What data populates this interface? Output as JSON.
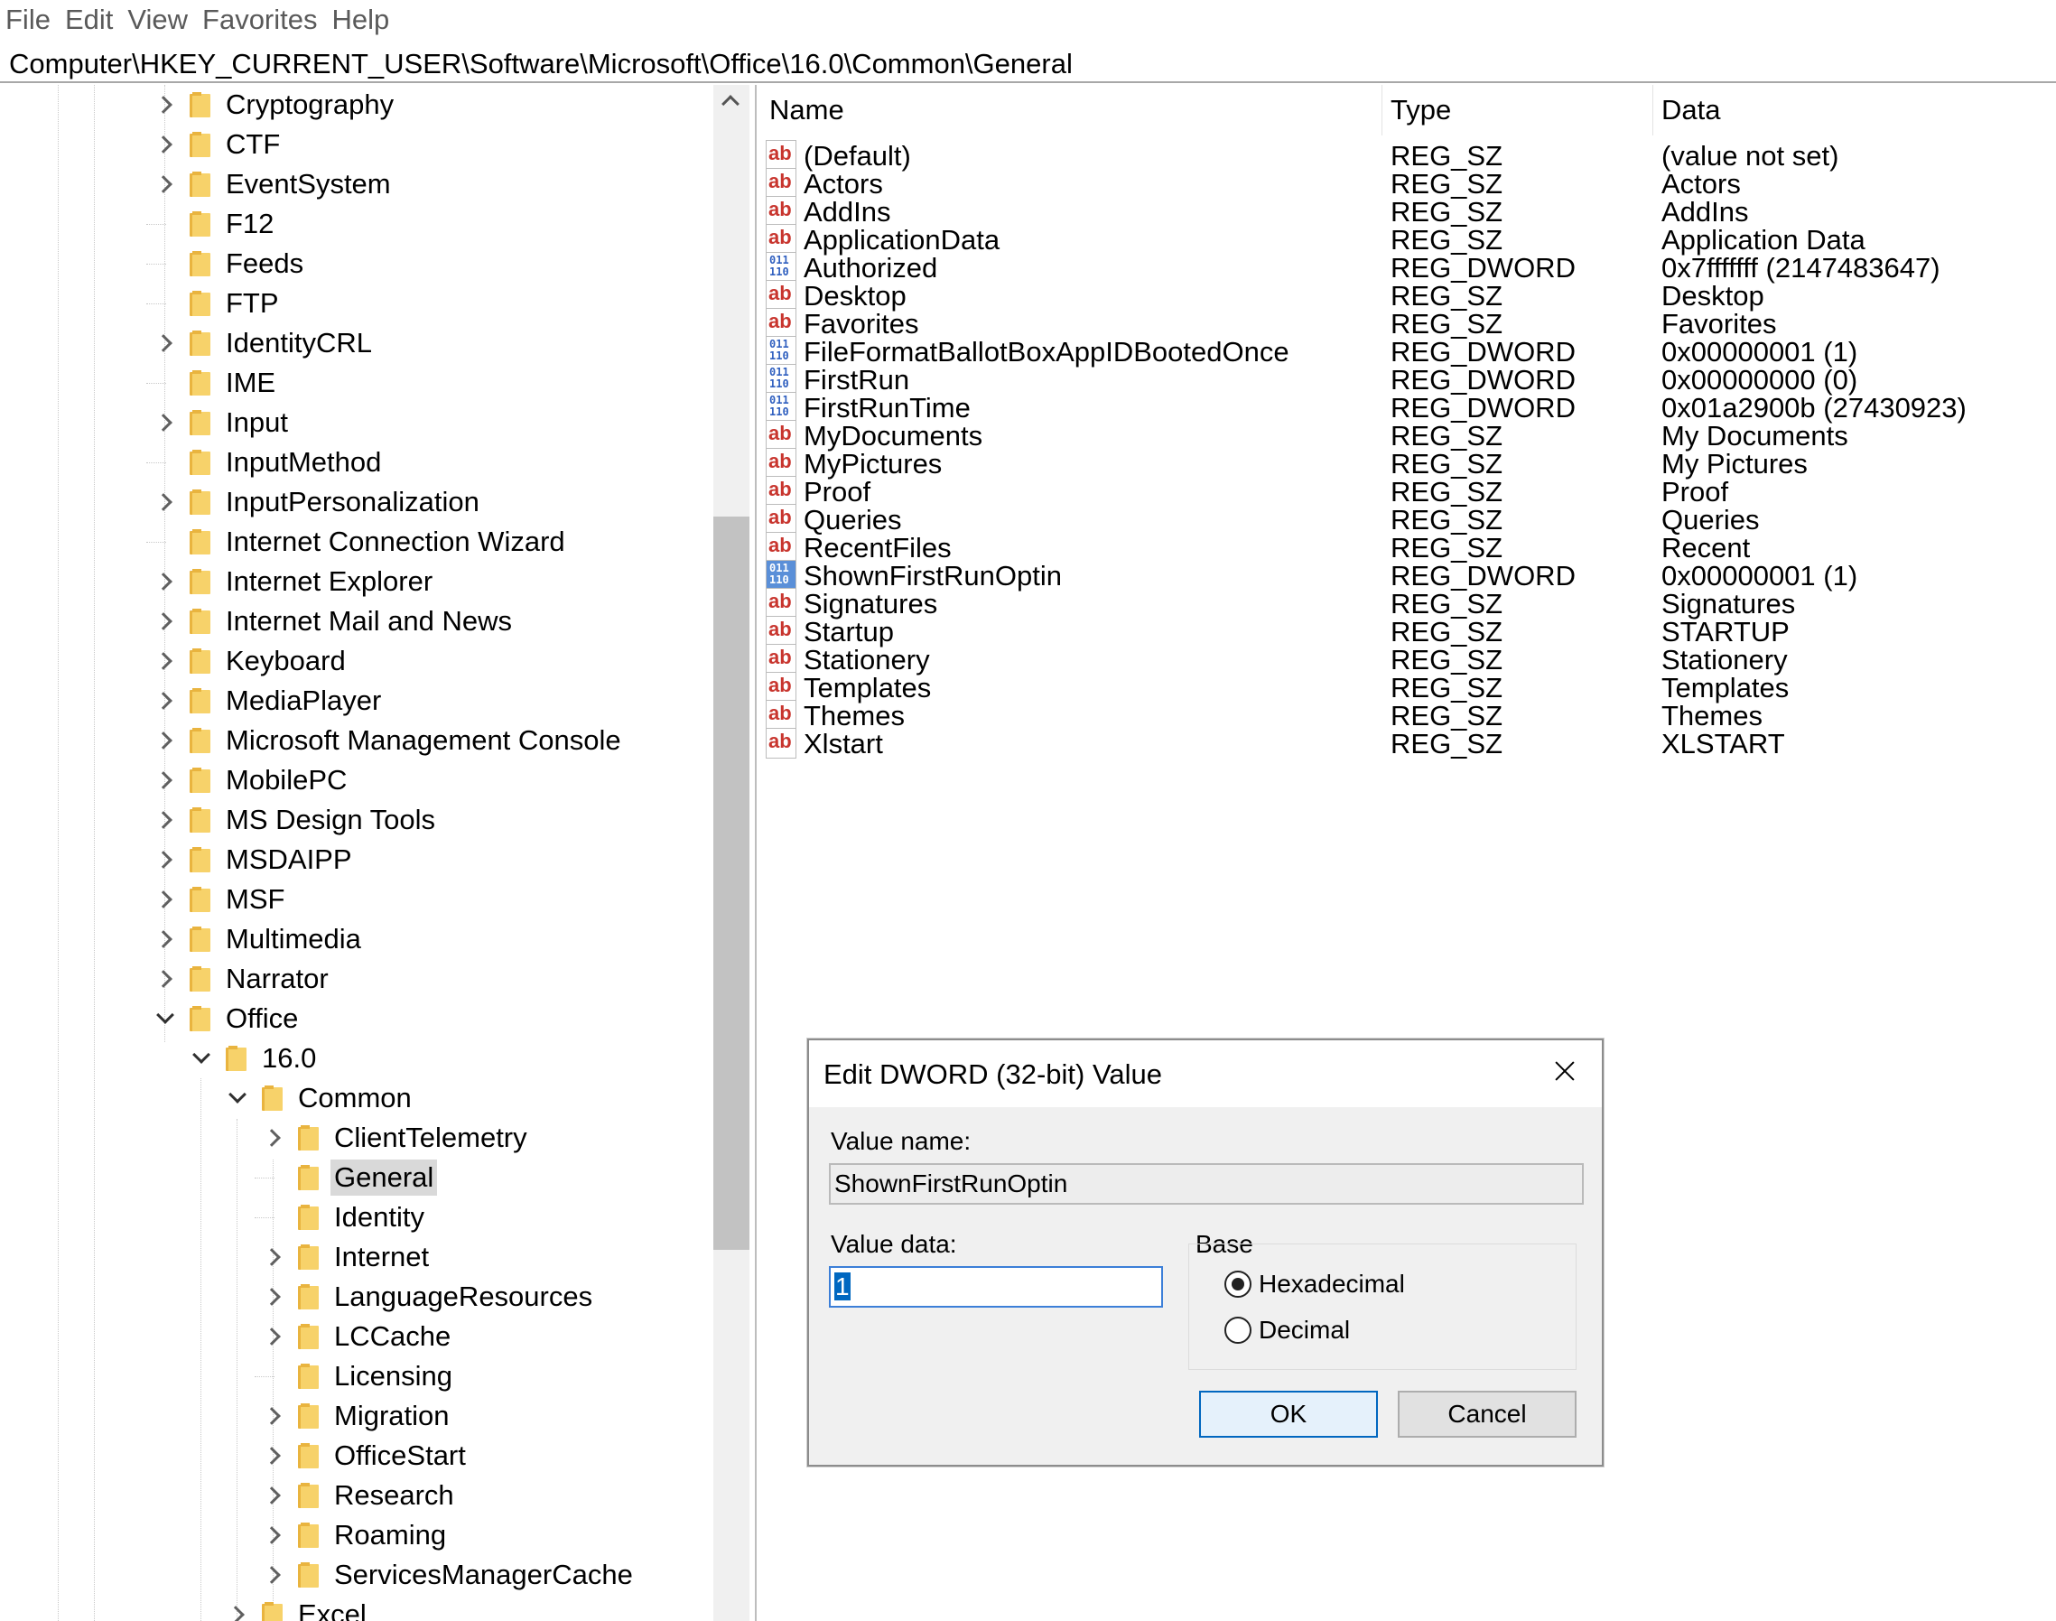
{
  "menu": [
    "File",
    "Edit",
    "View",
    "Favorites",
    "Help"
  ],
  "address": "Computer\\HKEY_CURRENT_USER\\Software\\Microsoft\\Office\\16.0\\Common\\General",
  "tree": [
    {
      "label": "Cryptography",
      "level": 0,
      "expander": "right"
    },
    {
      "label": "CTF",
      "level": 0,
      "expander": "right"
    },
    {
      "label": "EventSystem",
      "level": 0,
      "expander": "right"
    },
    {
      "label": "F12",
      "level": 0,
      "expander": "none"
    },
    {
      "label": "Feeds",
      "level": 0,
      "expander": "none"
    },
    {
      "label": "FTP",
      "level": 0,
      "expander": "none"
    },
    {
      "label": "IdentityCRL",
      "level": 0,
      "expander": "right"
    },
    {
      "label": "IME",
      "level": 0,
      "expander": "none"
    },
    {
      "label": "Input",
      "level": 0,
      "expander": "right"
    },
    {
      "label": "InputMethod",
      "level": 0,
      "expander": "none"
    },
    {
      "label": "InputPersonalization",
      "level": 0,
      "expander": "right"
    },
    {
      "label": "Internet Connection Wizard",
      "level": 0,
      "expander": "none"
    },
    {
      "label": "Internet Explorer",
      "level": 0,
      "expander": "right"
    },
    {
      "label": "Internet Mail and News",
      "level": 0,
      "expander": "right"
    },
    {
      "label": "Keyboard",
      "level": 0,
      "expander": "right"
    },
    {
      "label": "MediaPlayer",
      "level": 0,
      "expander": "right"
    },
    {
      "label": "Microsoft Management Console",
      "level": 0,
      "expander": "right"
    },
    {
      "label": "MobilePC",
      "level": 0,
      "expander": "right"
    },
    {
      "label": "MS Design Tools",
      "level": 0,
      "expander": "right"
    },
    {
      "label": "MSDAIPP",
      "level": 0,
      "expander": "right"
    },
    {
      "label": "MSF",
      "level": 0,
      "expander": "right"
    },
    {
      "label": "Multimedia",
      "level": 0,
      "expander": "right"
    },
    {
      "label": "Narrator",
      "level": 0,
      "expander": "right"
    },
    {
      "label": "Office",
      "level": 0,
      "expander": "down"
    },
    {
      "label": "16.0",
      "level": 1,
      "expander": "down"
    },
    {
      "label": "Common",
      "level": 2,
      "expander": "down"
    },
    {
      "label": "ClientTelemetry",
      "level": 3,
      "expander": "right"
    },
    {
      "label": "General",
      "level": 3,
      "expander": "none",
      "selected": true
    },
    {
      "label": "Identity",
      "level": 3,
      "expander": "none"
    },
    {
      "label": "Internet",
      "level": 3,
      "expander": "right"
    },
    {
      "label": "LanguageResources",
      "level": 3,
      "expander": "right"
    },
    {
      "label": "LCCache",
      "level": 3,
      "expander": "right"
    },
    {
      "label": "Licensing",
      "level": 3,
      "expander": "none"
    },
    {
      "label": "Migration",
      "level": 3,
      "expander": "right"
    },
    {
      "label": "OfficeStart",
      "level": 3,
      "expander": "right"
    },
    {
      "label": "Research",
      "level": 3,
      "expander": "right"
    },
    {
      "label": "Roaming",
      "level": 3,
      "expander": "right"
    },
    {
      "label": "ServicesManagerCache",
      "level": 3,
      "expander": "right"
    },
    {
      "label": "Excel",
      "level": 2,
      "expander": "right"
    }
  ],
  "list": {
    "headers": {
      "name": "Name",
      "type": "Type",
      "data": "Data"
    },
    "rows": [
      {
        "name": "(Default)",
        "type": "REG_SZ",
        "data": "(value not set)",
        "icon": "string-value-icon"
      },
      {
        "name": "Actors",
        "type": "REG_SZ",
        "data": "Actors",
        "icon": "string-value-icon"
      },
      {
        "name": "AddIns",
        "type": "REG_SZ",
        "data": "AddIns",
        "icon": "string-value-icon"
      },
      {
        "name": "ApplicationData",
        "type": "REG_SZ",
        "data": "Application Data",
        "icon": "string-value-icon"
      },
      {
        "name": "Authorized",
        "type": "REG_DWORD",
        "data": "0x7fffffff (2147483647)",
        "icon": "binary-value-icon"
      },
      {
        "name": "Desktop",
        "type": "REG_SZ",
        "data": "Desktop",
        "icon": "string-value-icon"
      },
      {
        "name": "Favorites",
        "type": "REG_SZ",
        "data": "Favorites",
        "icon": "string-value-icon"
      },
      {
        "name": "FileFormatBallotBoxAppIDBootedOnce",
        "type": "REG_DWORD",
        "data": "0x00000001 (1)",
        "icon": "binary-value-icon"
      },
      {
        "name": "FirstRun",
        "type": "REG_DWORD",
        "data": "0x00000000 (0)",
        "icon": "binary-value-icon"
      },
      {
        "name": "FirstRunTime",
        "type": "REG_DWORD",
        "data": "0x01a2900b (27430923)",
        "icon": "binary-value-icon"
      },
      {
        "name": "MyDocuments",
        "type": "REG_SZ",
        "data": "My Documents",
        "icon": "string-value-icon"
      },
      {
        "name": "MyPictures",
        "type": "REG_SZ",
        "data": "My Pictures",
        "icon": "string-value-icon"
      },
      {
        "name": "Proof",
        "type": "REG_SZ",
        "data": "Proof",
        "icon": "string-value-icon"
      },
      {
        "name": "Queries",
        "type": "REG_SZ",
        "data": "Queries",
        "icon": "string-value-icon"
      },
      {
        "name": "RecentFiles",
        "type": "REG_SZ",
        "data": "Recent",
        "icon": "string-value-icon"
      },
      {
        "name": "ShownFirstRunOptin",
        "type": "REG_DWORD",
        "data": "0x00000001 (1)",
        "icon": "binary-value-icon",
        "selected": true
      },
      {
        "name": "Signatures",
        "type": "REG_SZ",
        "data": "Signatures",
        "icon": "string-value-icon"
      },
      {
        "name": "Startup",
        "type": "REG_SZ",
        "data": "STARTUP",
        "icon": "string-value-icon"
      },
      {
        "name": "Stationery",
        "type": "REG_SZ",
        "data": "Stationery",
        "icon": "string-value-icon"
      },
      {
        "name": "Templates",
        "type": "REG_SZ",
        "data": "Templates",
        "icon": "string-value-icon"
      },
      {
        "name": "Themes",
        "type": "REG_SZ",
        "data": "Themes",
        "icon": "string-value-icon"
      },
      {
        "name": "Xlstart",
        "type": "REG_SZ",
        "data": "XLSTART",
        "icon": "string-value-icon"
      }
    ]
  },
  "icon_glyphs": {
    "string": "ab",
    "binary": "011\n110"
  },
  "dialog": {
    "title": "Edit DWORD (32-bit) Value",
    "value_name_label": "Value name:",
    "value_name": "ShownFirstRunOptin",
    "value_data_label": "Value data:",
    "value_data": "1",
    "base_label": "Base",
    "hex_label": "Hexadecimal",
    "dec_label": "Decimal",
    "selected_base": "hex",
    "ok_label": "OK",
    "cancel_label": "Cancel"
  },
  "colors": {
    "string_icon": "#c8352e",
    "binary_icon": "#2f5fbf",
    "selection_blue": "#0067c0",
    "tree_selected": "#d9d9d9",
    "folder": "#f7d26a"
  }
}
